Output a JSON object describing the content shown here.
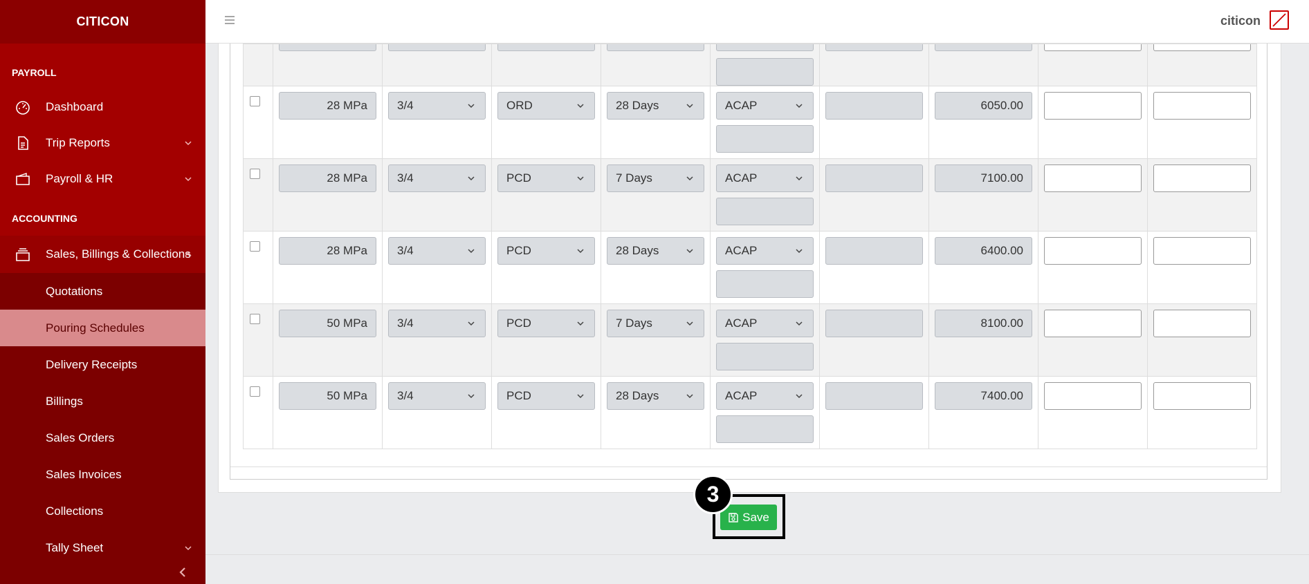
{
  "brand": "CITICON",
  "user": {
    "name": "citicon"
  },
  "sidebar": {
    "payroll_heading": "PAYROLL",
    "accounting_heading": "ACCOUNTING",
    "payroll_items": [
      {
        "label": "Dashboard",
        "icon": "dashboard-icon"
      },
      {
        "label": "Trip Reports",
        "icon": "document-icon"
      },
      {
        "label": "Payroll & HR",
        "icon": "wallet-icon"
      }
    ],
    "sales_item": {
      "label": "Sales, Billings & Collections",
      "icon": "stack-icon"
    },
    "sub_items": [
      {
        "label": "Quotations"
      },
      {
        "label": "Pouring Schedules",
        "active": true
      },
      {
        "label": "Delivery Receipts"
      },
      {
        "label": "Billings"
      },
      {
        "label": "Sales Orders"
      },
      {
        "label": "Sales Invoices"
      },
      {
        "label": "Collections"
      },
      {
        "label": "Tally Sheet"
      }
    ]
  },
  "table": {
    "rows": [
      {
        "strength": "28 MPa",
        "aggregate": "3/4",
        "cement": "ORD",
        "days": "28 Days",
        "plant": "ACAP",
        "price": "6050.00"
      },
      {
        "strength": "28 MPa",
        "aggregate": "3/4",
        "cement": "PCD",
        "days": "7 Days",
        "plant": "ACAP",
        "price": "7100.00"
      },
      {
        "strength": "28 MPa",
        "aggregate": "3/4",
        "cement": "PCD",
        "days": "28 Days",
        "plant": "ACAP",
        "price": "6400.00"
      },
      {
        "strength": "50 MPa",
        "aggregate": "3/4",
        "cement": "PCD",
        "days": "7 Days",
        "plant": "ACAP",
        "price": "8100.00"
      },
      {
        "strength": "50 MPa",
        "aggregate": "3/4",
        "cement": "PCD",
        "days": "28 Days",
        "plant": "ACAP",
        "price": "7400.00"
      }
    ]
  },
  "actions": {
    "save_label": "Save",
    "step_number": "3"
  },
  "colors": {
    "sidebar": "#7c0000",
    "sidebar_top": "#a30000",
    "active_item": "#d98a8c",
    "save": "#28b24b"
  }
}
